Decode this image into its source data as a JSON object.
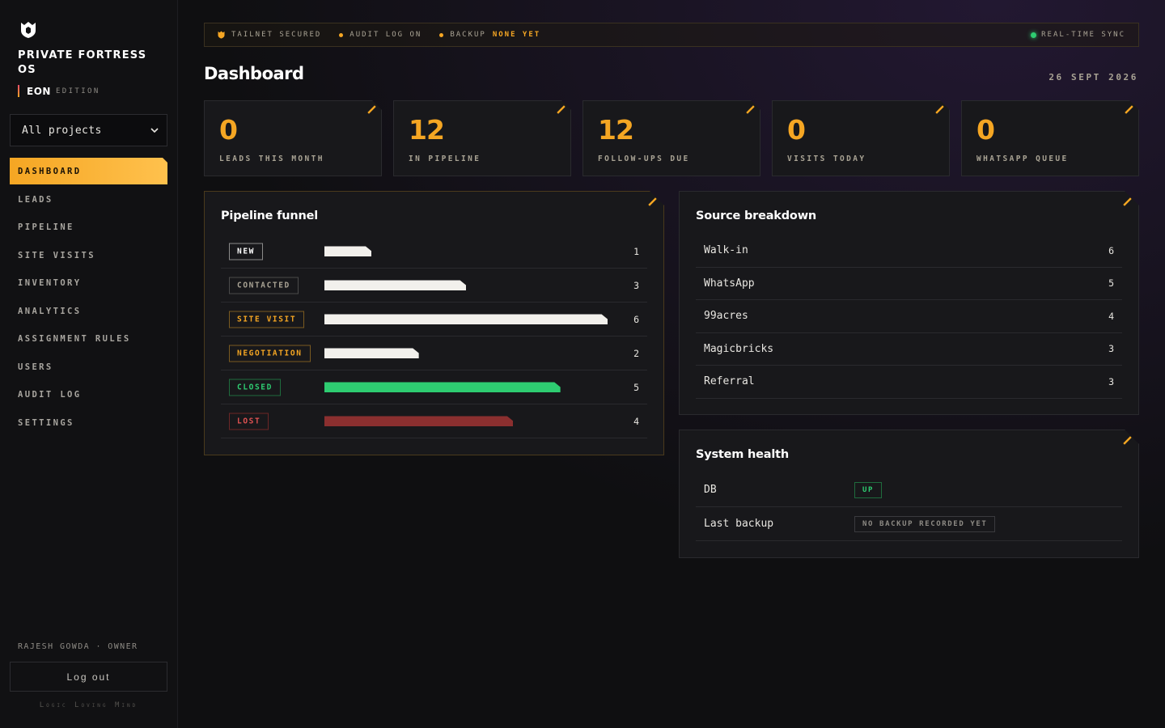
{
  "brand": {
    "name": "PRIVATE FORTRESS OS",
    "edition_name": "EON",
    "edition_label": "EDITION",
    "tagline": "Logic Loving Mind"
  },
  "colors": {
    "accent": "#f5a623",
    "background": "#0f0f11",
    "panel": "#18181b",
    "success": "#2ecc71",
    "danger": "#8b2f2f"
  },
  "project_select": {
    "value": "All projects"
  },
  "nav": {
    "items": [
      {
        "label": "DASHBOARD",
        "active": true
      },
      {
        "label": "LEADS"
      },
      {
        "label": "PIPELINE"
      },
      {
        "label": "SITE VISITS"
      },
      {
        "label": "INVENTORY"
      },
      {
        "label": "ANALYTICS"
      },
      {
        "label": "ASSIGNMENT RULES"
      },
      {
        "label": "USERS"
      },
      {
        "label": "AUDIT LOG"
      },
      {
        "label": "SETTINGS"
      }
    ]
  },
  "user": {
    "line": "RAJESH GOWDA · OWNER",
    "logout": "Log out"
  },
  "status": {
    "tailnet": "TAILNET SECURED",
    "audit": "AUDIT LOG ON",
    "backup_prefix": "BACKUP",
    "backup_value": "NONE YET",
    "sync": "REAL-TIME SYNC"
  },
  "page": {
    "title": "Dashboard",
    "date": "26 SEPT 2026"
  },
  "stats": [
    {
      "value": "0",
      "label": "LEADS THIS MONTH"
    },
    {
      "value": "12",
      "label": "IN PIPELINE"
    },
    {
      "value": "12",
      "label": "FOLLOW-UPS DUE"
    },
    {
      "value": "0",
      "label": "VISITS TODAY"
    },
    {
      "value": "0",
      "label": "WHATSAPP QUEUE"
    }
  ],
  "funnel": {
    "title": "Pipeline funnel",
    "max": 6,
    "stages": [
      {
        "label": "NEW",
        "count": 1,
        "color": "#f2f0ec"
      },
      {
        "label": "CONTACTED",
        "count": 3,
        "color": "#f2f0ec"
      },
      {
        "label": "SITE VISIT",
        "count": 6,
        "color": "#f2f0ec"
      },
      {
        "label": "NEGOTIATION",
        "count": 2,
        "color": "#f2f0ec"
      },
      {
        "label": "CLOSED",
        "count": 5,
        "color": "#2ecc71"
      },
      {
        "label": "LOST",
        "count": 4,
        "color": "#8b2f2f"
      }
    ]
  },
  "sources": {
    "title": "Source breakdown",
    "items": [
      {
        "name": "Walk-in",
        "count": 6
      },
      {
        "name": "WhatsApp",
        "count": 5
      },
      {
        "name": "99acres",
        "count": 4
      },
      {
        "name": "Magicbricks",
        "count": 3
      },
      {
        "name": "Referral",
        "count": 3
      }
    ]
  },
  "health": {
    "title": "System health",
    "db_label": "DB",
    "db_status": "UP",
    "backup_label": "Last backup",
    "backup_status": "NO BACKUP RECORDED YET"
  }
}
